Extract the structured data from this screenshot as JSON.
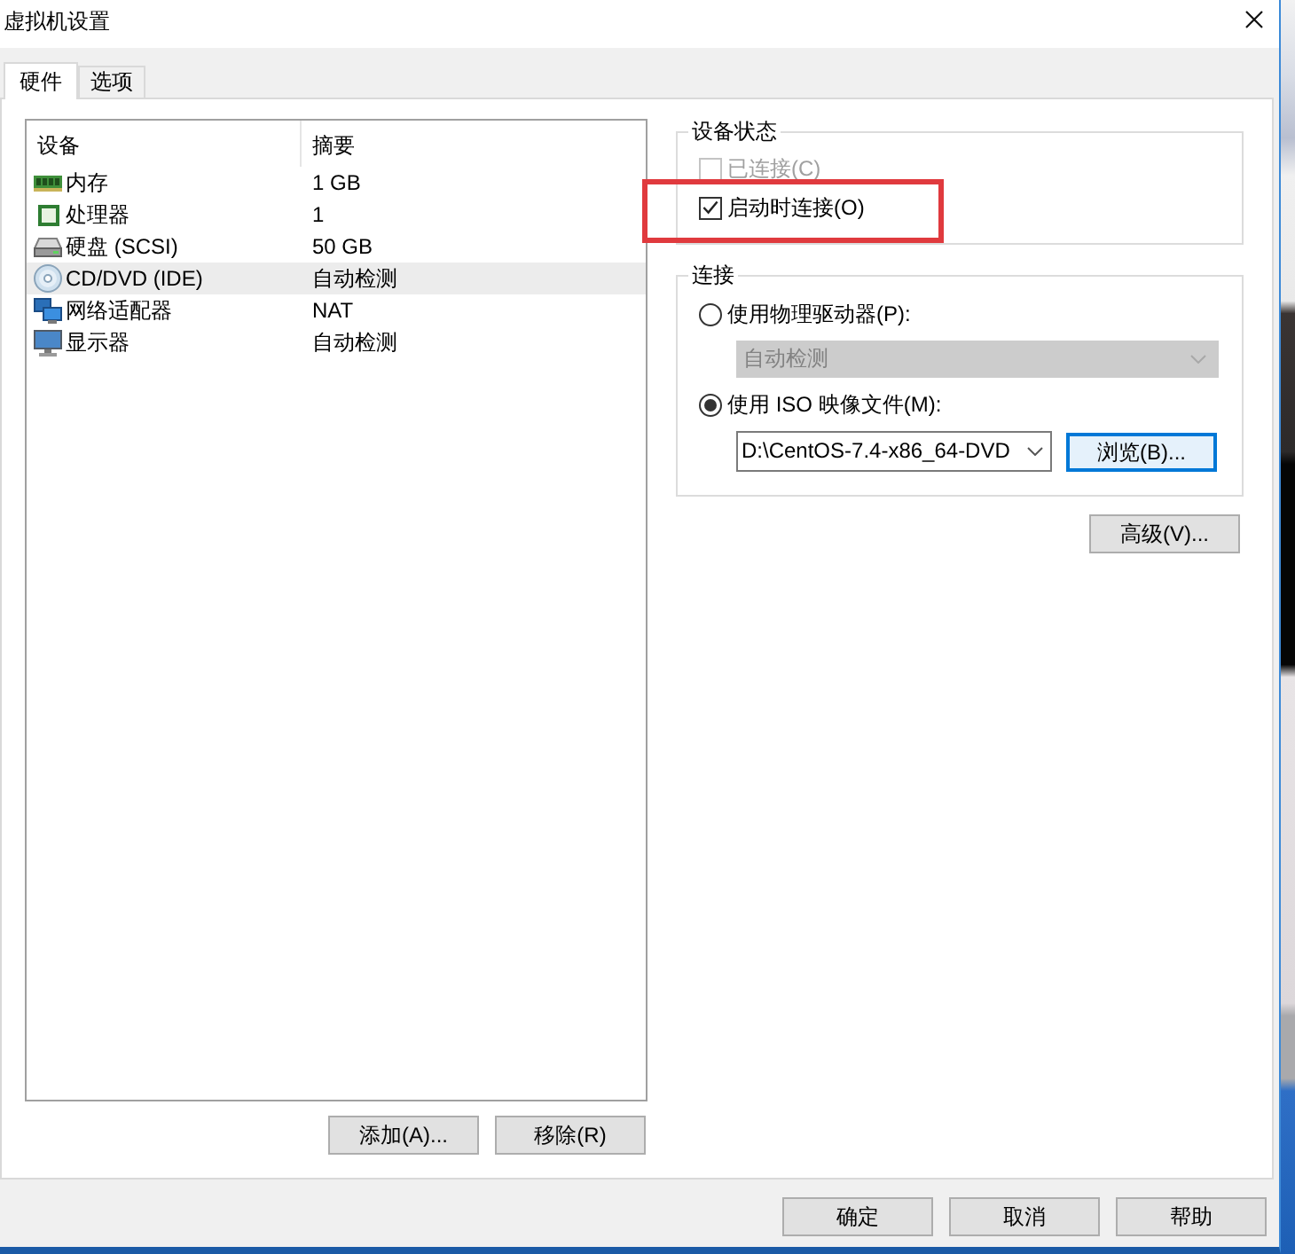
{
  "window": {
    "title": "虚拟机设置"
  },
  "tabs": [
    {
      "label": "硬件",
      "selected": true
    },
    {
      "label": "选项",
      "selected": false
    }
  ],
  "device_list": {
    "columns": [
      "设备",
      "摘要"
    ],
    "rows": [
      {
        "kind": "memory",
        "device": "内存",
        "summary": "1 GB",
        "selected": false
      },
      {
        "kind": "processor",
        "device": "处理器",
        "summary": "1",
        "selected": false
      },
      {
        "kind": "hard_disk",
        "device": "硬盘 (SCSI)",
        "summary": "50 GB",
        "selected": false
      },
      {
        "kind": "cd_dvd",
        "device": "CD/DVD (IDE)",
        "summary": "自动检测",
        "selected": true
      },
      {
        "kind": "network",
        "device": "网络适配器",
        "summary": "NAT",
        "selected": false
      },
      {
        "kind": "display",
        "device": "显示器",
        "summary": "自动检测",
        "selected": false
      }
    ]
  },
  "device_buttons": [
    "添加(A)...",
    "移除(R)"
  ],
  "device_status": {
    "title": "设备状态",
    "options": [
      {
        "label": "已连接(C)",
        "checked": false,
        "disabled": true,
        "highlighted": false
      },
      {
        "label": "启动时连接(O)",
        "checked": true,
        "disabled": false,
        "highlighted": true
      }
    ]
  },
  "connection": {
    "title": "连接",
    "sources": [
      {
        "kind": "physical_drive",
        "label": "使用物理驱动器(P):",
        "selected": false,
        "drive": {
          "value": "自动检测",
          "disabled": true
        }
      },
      {
        "kind": "iso_image",
        "label": "使用 ISO 映像文件(M):",
        "selected": true,
        "file": {
          "value": "D:\\CentOS-7.4-x86_64-DVD"
        },
        "browse_button": {
          "label": "浏览(B)...",
          "focused": true
        }
      }
    ]
  },
  "advanced_button": "高级(V)...",
  "dialog_buttons": [
    "确定",
    "取消",
    "帮助"
  ]
}
